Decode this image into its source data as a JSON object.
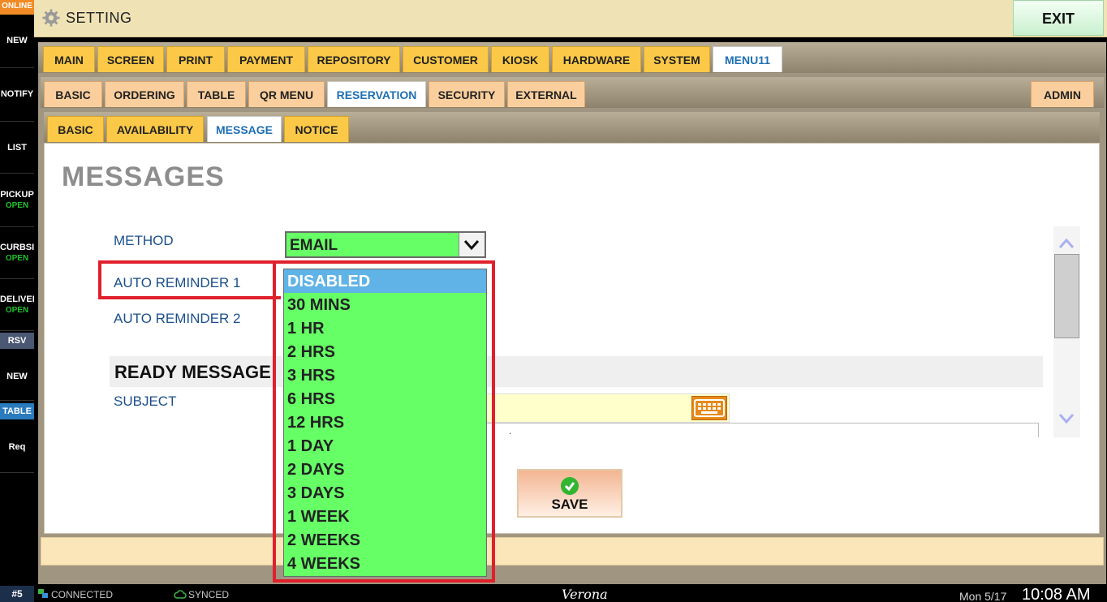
{
  "sidebar": {
    "online_badge": "ONLINE",
    "items": [
      {
        "label": "NEW",
        "sub": ""
      },
      {
        "label": "NOTIFY",
        "sub": ""
      },
      {
        "label": "LIST",
        "sub": ""
      },
      {
        "label": "PICKUP",
        "sub": "OPEN"
      },
      {
        "label": "CURBSID",
        "sub": "OPEN"
      },
      {
        "label": "DELIVER",
        "sub": "OPEN"
      }
    ],
    "rsv_tag": "RSV",
    "rsv_new": "NEW",
    "table_tag": "TABLE",
    "req": "Req"
  },
  "titlebar": {
    "title": "SETTING",
    "exit_label": "EXIT"
  },
  "tabs_level1": [
    "MAIN",
    "SCREEN",
    "PRINT",
    "PAYMENT",
    "REPOSITORY",
    "CUSTOMER",
    "KIOSK",
    "HARDWARE",
    "SYSTEM",
    "MENU11"
  ],
  "tabs_level2": [
    "BASIC",
    "ORDERING",
    "TABLE",
    "QR MENU",
    "RESERVATION",
    "SECURITY",
    "EXTERNAL"
  ],
  "tab_admin": "ADMIN",
  "tabs_level3": [
    "BASIC",
    "AVAILABILITY",
    "MESSAGE",
    "NOTICE"
  ],
  "panel": {
    "page_title": "MESSAGES",
    "method_label": "METHOD",
    "method_value": "EMAIL",
    "auto_reminder_1_label": "AUTO REMINDER 1",
    "auto_reminder_2_label": "AUTO REMINDER 2",
    "ready_message_title": "READY MESSAGE",
    "subject_label": "SUBJECT",
    "message_text": ".",
    "save_label": "SAVE"
  },
  "dropdown_options": [
    "DISABLED",
    "30 MINS",
    "1 HR",
    "2 HRS",
    "3 HRS",
    "6 HRS",
    "12 HRS",
    "1 DAY",
    "2 DAYS",
    "3 DAYS",
    "1 WEEK",
    "2 WEEKS",
    "4 WEEKS"
  ],
  "dropdown_selected": "DISABLED",
  "statusbar": {
    "station": "#5",
    "connected": "CONNECTED",
    "synced": "SYNCED",
    "app_name": "Verona",
    "date": "Mon 5/17",
    "time": "10:08 AM"
  },
  "colors": {
    "tab_gold": "#fbc947",
    "tab_peach": "#fbcf9d",
    "active_tab_text": "#1e6fb3",
    "dropdown_green": "#66ff66",
    "dropdown_selected": "#5fb3e6",
    "highlight_red": "#e0202c",
    "status_open": "#22c02a"
  }
}
